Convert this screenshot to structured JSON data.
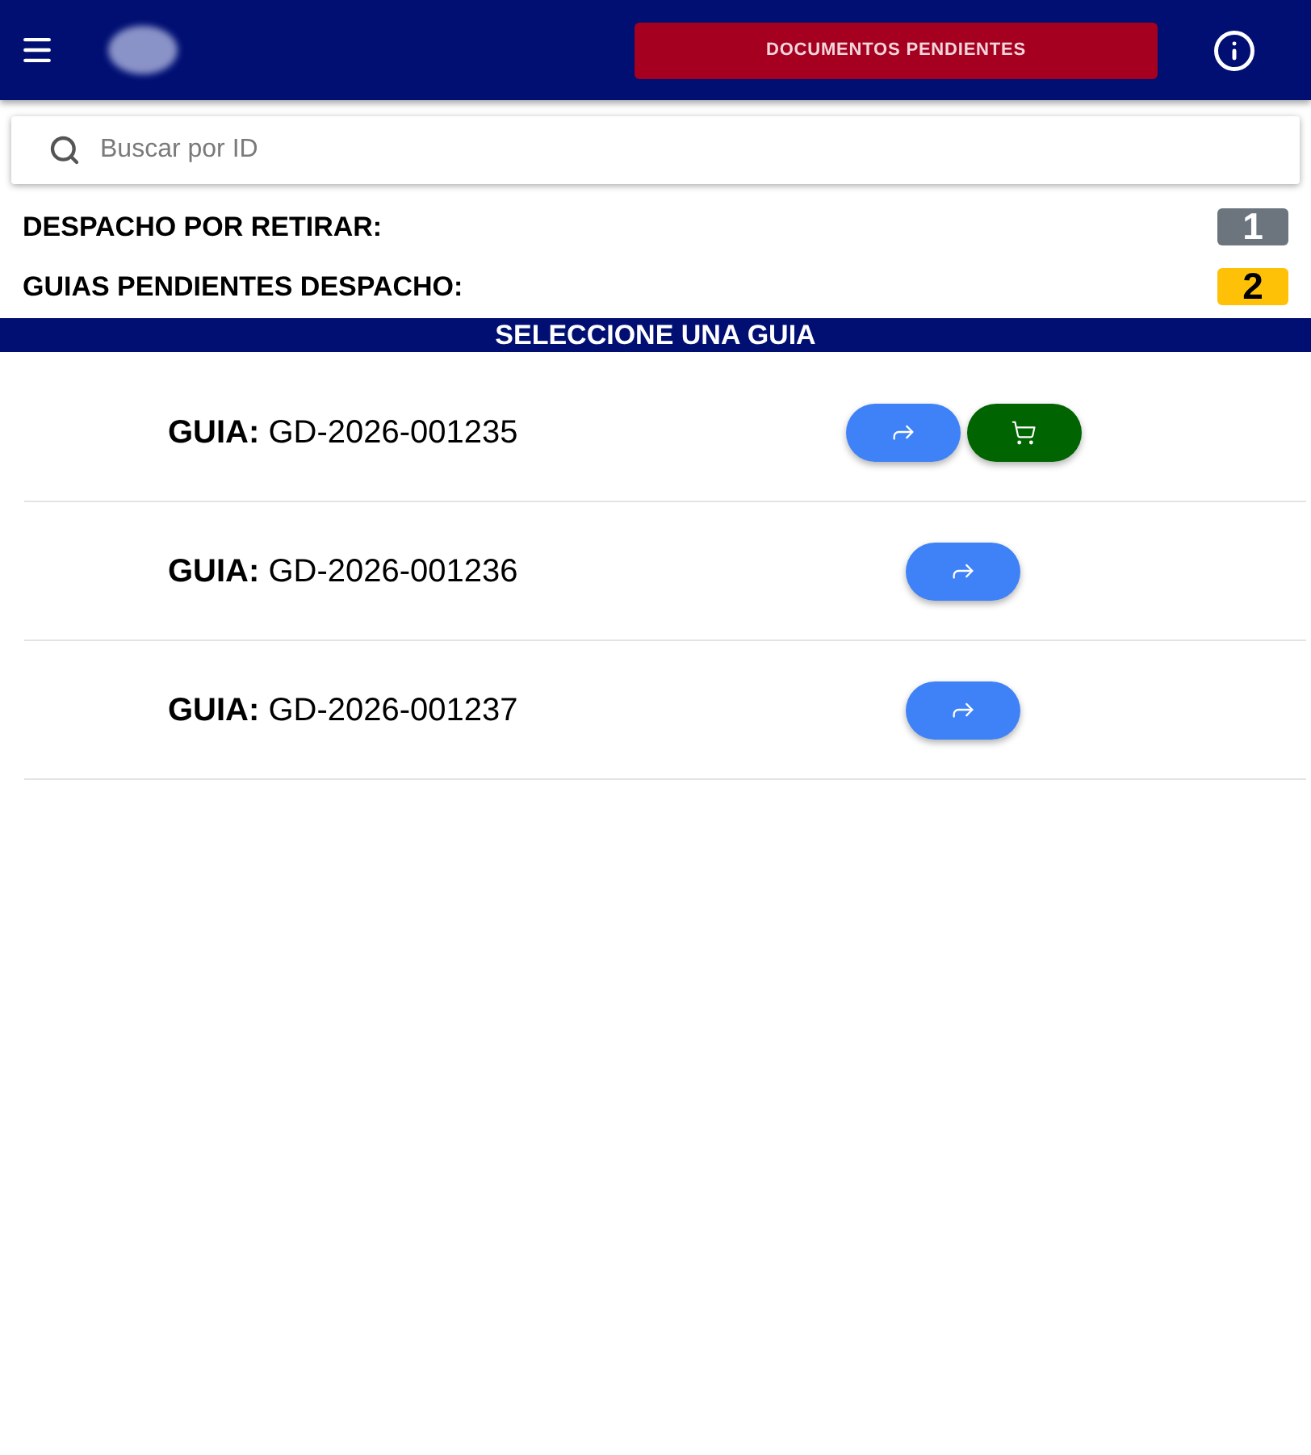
{
  "header": {
    "pending_button": "DOCUMENTOS PENDIENTES"
  },
  "search": {
    "placeholder": "Buscar por ID"
  },
  "counters": [
    {
      "label": "DESPACHO POR RETIRAR:",
      "value": "1",
      "color": "#6c757d"
    },
    {
      "label": "GUIAS PENDIENTES DESPACHO:",
      "value": "2",
      "color": "#ffc107"
    }
  ],
  "banner": "SELECCIONE UNA GUIA",
  "guides": [
    {
      "label": "GUIA:",
      "id": "GD-2026-001235",
      "actions": [
        {
          "kind": "forward"
        },
        {
          "kind": "cart"
        }
      ]
    },
    {
      "label": "GUIA:",
      "id": "GD-2026-001236",
      "actions": [
        {
          "kind": "forward"
        }
      ]
    },
    {
      "label": "GUIA:",
      "id": "GD-2026-001237",
      "actions": [
        {
          "kind": "forward"
        }
      ]
    }
  ]
}
